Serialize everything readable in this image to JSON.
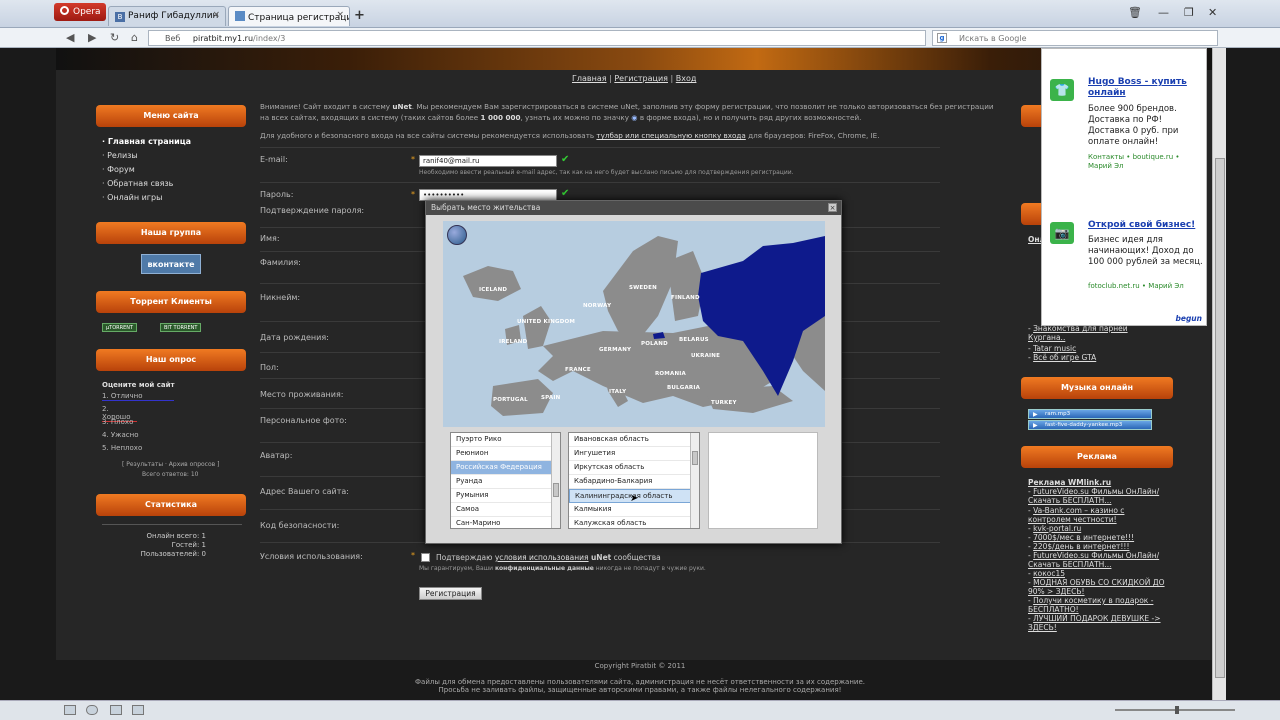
{
  "browser": {
    "menu_label": "Opera",
    "tabs": [
      {
        "label": "Раниф Гибадуллин",
        "icon": "B"
      },
      {
        "label": "Страница регистраци...",
        "icon": ""
      }
    ],
    "new_tab": "+",
    "address_prefix": "Веб",
    "url_domain": "piratbit.my1.ru",
    "url_path": "/index/3",
    "search_placeholder": "Искать в Google",
    "search_engine_icon": "g"
  },
  "header_links": [
    "Главная",
    "Регистрация",
    "Вход"
  ],
  "left": {
    "menu_title": "Меню сайта",
    "menu": [
      "Главная страница",
      "Релизы",
      "Форум",
      "Обратная связь",
      "Онлайн игры"
    ],
    "group_title": "Наша группа",
    "vk_label": "вконтакте",
    "torrent_title": "Торрент Клиенты",
    "torrent_badges": [
      "µTORRENT",
      "BIT TORRENT"
    ],
    "poll_title": "Наш опрос",
    "poll_question": "Оцените мой сайт",
    "poll_options": [
      "1. Отлично",
      "2. Хорошо",
      "3. Плохо",
      "4. Ужасно",
      "5. Неплохо"
    ],
    "poll_links": "[ Результаты · Архив опросов ]",
    "poll_total": "Всего ответов: 10",
    "stats_title": "Статистика",
    "stats": [
      "Онлайн всего: 1",
      "Гостей: 1",
      "Пользователей: 0"
    ]
  },
  "form": {
    "intro_a": "Внимание! Сайт входит в систему",
    "intro_unet": "uNet",
    "intro_b": ". Мы рекомендуем Вам зарегистрироваться в системе uNet, заполнив эту форму регистрации, что позволит не только авторизоваться без регистрации на всех сайтах, входящих в систему (таких сайтов более",
    "intro_count": "1 000 000",
    "intro_c": ", узнать их можно по значку",
    "intro_d": "в форме входа), но и получить ряд других возможностей.",
    "intro2_a": "Для удобного и безопасного входа на все сайты системы рекомендуется использовать",
    "intro2_link": "тулбар или специальную кнопку входа",
    "intro2_b": "для браузеров: FireFox, Chrome, IE.",
    "labels": [
      "E-mail:",
      "Пароль:",
      "Подтверждение пароля:",
      "Имя:",
      "Фамилия:",
      "Никнейм:",
      "Дата рождения:",
      "Пол:",
      "Место проживания:",
      "Персональное фото:",
      "Аватар:",
      "Адрес Вашего сайта:",
      "Код безопасности:",
      "Условия использования:"
    ],
    "email_value": "ranif40@mail.ru",
    "email_hint": "Необходимо ввести реальный e-mail адрес, так как на него будет выслано письмо для подтверждения регистрации.",
    "password_value": "••••••••••",
    "terms_a": "Подтверждаю",
    "terms_link": "условия использования",
    "terms_b": "uNet",
    "terms_c": "сообщества",
    "privacy_a": "Мы гарантируем, Ваши",
    "privacy_b": "конфиденциальные данные",
    "privacy_c": "никогда не попадут в чужие руки.",
    "submit": "Регистрация"
  },
  "modal": {
    "title": "Выбрать место жительства",
    "countries": [
      "Пуэрто Рико",
      "Реюнион",
      "Российская Федерация",
      "Руанда",
      "Румыния",
      "Самоа",
      "Сан-Марино"
    ],
    "selected_country": "Российская Федерация",
    "regions": [
      "Ивановская область",
      "Ингушетия",
      "Иркутская область",
      "Кабардино-Балкария",
      "Калининградская область",
      "Калмыкия",
      "Калужская область"
    ],
    "hovered_region": "Калининградская область",
    "map_labels": [
      "ICELAND",
      "SWEDEN",
      "FINLAND",
      "NORWAY",
      "UNITED KINGDOM",
      "IRELAND",
      "GERMANY",
      "POLAND",
      "BELARUS",
      "UKRAINE",
      "FRANCE",
      "ROMANIA",
      "BULGARIA",
      "SPAIN",
      "PORTUGAL",
      "ITALY",
      "TURKEY"
    ]
  },
  "right": {
    "music_title": "Музыка онлайн",
    "tracks": [
      "ram.mp3",
      "fast-five-daddy-yankee.mp3"
    ],
    "ads_title": "Реклама",
    "ads_header": "Реклама WMlink.ru",
    "ads": [
      "FutureVideo.su Фильмы ОнЛайн/ Скачать БЕСПЛАТН...",
      "Va-Bank.com – казино с контролем честности!",
      "kvk-portal.ru",
      "7000$/мес в интернете!!!",
      "220$/день в интернет!!!",
      "FutureVideo.su Фильмы ОнЛайн/ Скачать БЕСПЛАТН...",
      "кокос15",
      "МОДНАЯ ОБУВЬ СО СКИДКОЙ ДО 90% > ЗДЕСЬ!",
      "Получи косметику в подарок - БЕСПЛАТНО!",
      "ЛУЧШИЙ ПОДАРОК ДЕВУШКЕ -> ЗДЕСЬ!"
    ],
    "partial_links": [
      "Знакомства для парней Кургана..",
      "Tatar music",
      "Всё об игре GTA"
    ]
  },
  "ad_panel": {
    "ad1_title": "Hugo Boss - купить онлайн",
    "ad1_text": "Более 900 брендов. Доставка по РФ! Доставка 0 руб. при оплате онлайн!",
    "ad1_src": "Контакты • boutique.ru • Марий Эл",
    "ad2_title": "Открой свой бизнес!",
    "ad2_text": "Бизнес идея для начинающих! Доход до 100 000 рублей за месяц.",
    "ad2_src": "fotoclub.net.ru • Марий Эл",
    "brand": "begun"
  },
  "footer": {
    "copyright": "Copyright Piratbit © 2011",
    "line1": "Файлы для обмена предоставлены пользователями сайта, администрация не несёт ответственности за их содержание.",
    "line2": "Просьба не заливать файлы, защищенные авторскими правами, а также файлы нелегального содержания!"
  }
}
